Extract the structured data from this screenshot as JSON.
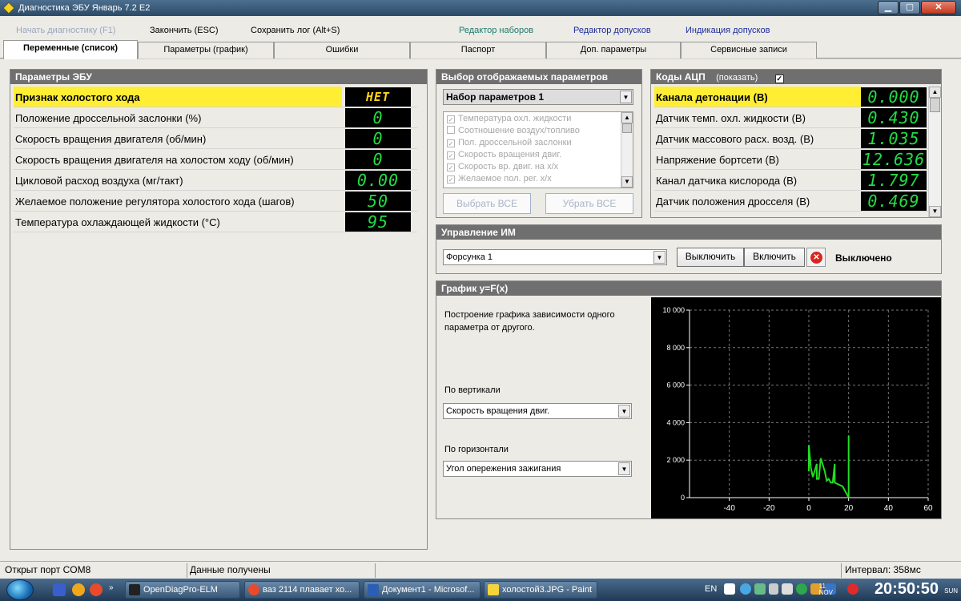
{
  "window": {
    "title": "Диагностика ЭБУ Январь 7.2 E2"
  },
  "commands": {
    "start": "Начать диагностику (F1)",
    "finish": "Закончить (ESC)",
    "save_log": "Сохранить лог (Alt+S)",
    "sets_editor": "Редактор наборов",
    "tolerance_editor": "Редактор допусков",
    "tolerance_indication": "Индикация допусков"
  },
  "tabs": [
    "Переменные (список)",
    "Параметры (график)",
    "Ошибки",
    "Паспорт",
    "Доп. параметры",
    "Сервисные записи"
  ],
  "ecu_panel": {
    "title": "Параметры ЭБУ",
    "rows": [
      {
        "label": "Признак холостого хода",
        "value": "НЕТ"
      },
      {
        "label": "Положение дроссельной заслонки (%)",
        "value": "0"
      },
      {
        "label": "Скорость вращения двигателя (об/мин)",
        "value": "0"
      },
      {
        "label": "Скорость вращения двигателя на холостом ходу (об/мин)",
        "value": "0"
      },
      {
        "label": "Цикловой расход воздуха (мг/такт)",
        "value": "0.00"
      },
      {
        "label": "Желаемое положение регулятора холостого хода (шагов)",
        "value": "50"
      },
      {
        "label": "Температура охлаждающей жидкости (°C)",
        "value": "95"
      }
    ]
  },
  "select_panel": {
    "title": "Выбор отображаемых параметров",
    "set_combo": "Набор параметров 1",
    "items": [
      {
        "label": "Температура охл. жидкости",
        "checked": true
      },
      {
        "label": "Соотношение воздух/топливо",
        "checked": false
      },
      {
        "label": "Пол. дроссельной заслонки",
        "checked": true
      },
      {
        "label": "Скорость вращения двиг.",
        "checked": true
      },
      {
        "label": "Скорость вр. двиг. на х/х",
        "checked": true
      },
      {
        "label": "Желаемое пол. рег. х/х",
        "checked": true
      }
    ],
    "select_all": "Выбрать ВСЕ",
    "deselect_all": "Убрать ВСЕ"
  },
  "adc_panel": {
    "title": "Коды АЦП",
    "show_label": "(показать)",
    "show_checked": true,
    "rows": [
      {
        "label": "Канала детонации (В)",
        "value": "0.000"
      },
      {
        "label": "Датчик темп. охл. жидкости (В)",
        "value": "0.430"
      },
      {
        "label": "Датчик массового расх. возд. (В)",
        "value": "1.035"
      },
      {
        "label": "Напряжение бортсети (В)",
        "value": "12.636"
      },
      {
        "label": "Канал датчика кислорода (В)",
        "value": "1.797"
      },
      {
        "label": "Датчик положения дросселя (В)",
        "value": "0.469"
      }
    ]
  },
  "actuator_panel": {
    "title": "Управление ИМ",
    "combo": "Форсунка 1",
    "off_button": "Выключить",
    "on_button": "Включить",
    "status": "Выключено"
  },
  "graph_panel": {
    "title": "График y=F(x)",
    "description": "Построение графика зависимости одного параметра от другого.",
    "vertical_label": "По вертикали",
    "vertical_value": "Скорость вращения двиг.",
    "horizontal_label": "По горизонтали",
    "horizontal_value": "Угол опережения зажигания"
  },
  "chart_data": {
    "type": "line",
    "title": "",
    "xlabel": "",
    "ylabel": "",
    "xlim": [
      -60,
      60
    ],
    "ylim": [
      0,
      10000
    ],
    "xticks": [
      -40,
      -20,
      0,
      20,
      40,
      60
    ],
    "yticks": [
      0,
      2000,
      4000,
      6000,
      8000,
      10000
    ],
    "ytick_labels": [
      "0",
      "2 000",
      "4 000",
      "6 000",
      "8 000",
      "10 000"
    ],
    "grid": true,
    "series": [
      {
        "color": "#22dd22",
        "x": [
          0,
          0,
          1,
          2,
          4,
          4,
          5,
          6,
          8,
          9,
          10,
          11,
          12,
          13,
          13,
          14,
          15,
          16,
          17,
          18,
          19,
          20,
          20,
          20,
          20
        ],
        "y": [
          1400,
          2800,
          1600,
          1100,
          1800,
          1000,
          1000,
          2100,
          1400,
          900,
          1000,
          800,
          800,
          1800,
          800,
          750,
          700,
          650,
          600,
          400,
          200,
          0,
          3300,
          600,
          0
        ]
      }
    ]
  },
  "status": {
    "port": "Открыт порт COM8",
    "data": "Данные получены",
    "interval": "Интервал: 358мс"
  },
  "taskbar": {
    "tasks": [
      "OpenDiagPro-ELM",
      "ваз 2114 плавает хо...",
      "Документ1 - Microsof...",
      "холостой3.JPG - Paint"
    ],
    "lang": "EN",
    "time": "20:50:50",
    "date_day": "11",
    "date_month": "NOV",
    "weekday": "SUN"
  },
  "colors": {
    "highlight": "#ffee33",
    "lcd_green": "#22dd44",
    "lcd_yellow": "#ffd21a",
    "panel_header": "#6f6f6f",
    "plot_line": "#22dd22"
  }
}
